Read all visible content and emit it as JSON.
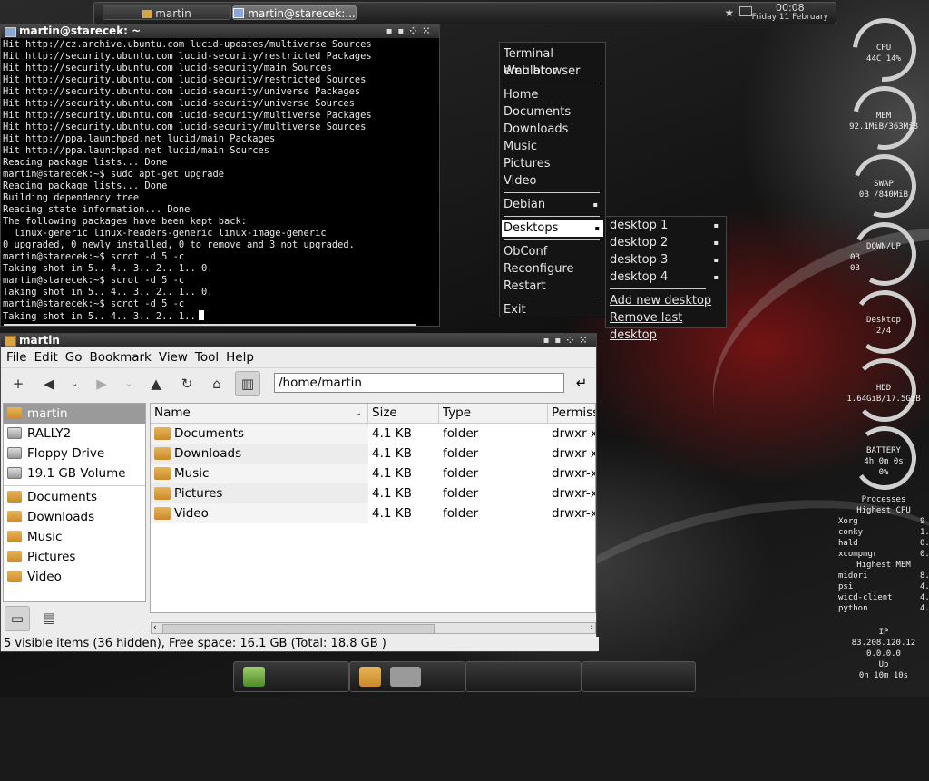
{
  "top_panel": {
    "tasks": [
      {
        "label": "martin",
        "icon": "folder-icon"
      },
      {
        "label": "martin@starecek:...",
        "icon": "terminal-icon"
      }
    ],
    "clock": {
      "time": "00:08",
      "date": "Friday 11 February"
    },
    "tray_icons": [
      "bookmark-star-icon",
      "network-icon"
    ]
  },
  "terminal": {
    "title": "martin@starecek: ~",
    "title_buttons": [
      "iconify-icon",
      "maximize-icon",
      "close-icon"
    ],
    "lines": [
      "Hit http://cz.archive.ubuntu.com lucid-updates/multiverse Sources",
      "Hit http://security.ubuntu.com lucid-security/restricted Packages",
      "Hit http://security.ubuntu.com lucid-security/main Sources",
      "Hit http://security.ubuntu.com lucid-security/restricted Sources",
      "Hit http://security.ubuntu.com lucid-security/universe Packages",
      "Hit http://security.ubuntu.com lucid-security/universe Sources",
      "Hit http://security.ubuntu.com lucid-security/multiverse Packages",
      "Hit http://security.ubuntu.com lucid-security/multiverse Sources",
      "Hit http://ppa.launchpad.net lucid/main Packages",
      "Hit http://ppa.launchpad.net lucid/main Sources",
      "Reading package lists... Done",
      "martin@starecek:~$ sudo apt-get upgrade",
      "Reading package lists... Done",
      "Building dependency tree",
      "Reading state information... Done",
      "The following packages have been kept back:",
      "  linux-generic linux-headers-generic linux-image-generic",
      "0 upgraded, 0 newly installed, 0 to remove and 3 not upgraded.",
      "martin@starecek:~$ scrot -d 5 -c",
      "Taking shot in 5.. 4.. 3.. 2.. 1.. 0.",
      "martin@starecek:~$ scrot -d 5 -c",
      "Taking shot in 5.. 4.. 3.. 2.. 1.. 0.",
      "martin@starecek:~$ scrot -d 5 -c",
      "Taking shot in 5.. 4.. 3.. 2.. 1.."
    ]
  },
  "root_menu": {
    "groups": [
      [
        "Terminal emulator",
        "Web browser"
      ],
      [
        "Home",
        "Documents",
        "Downloads",
        "Music",
        "Pictures",
        "Video"
      ],
      [
        "Debian"
      ],
      [
        "Desktops"
      ],
      [
        "ObConf",
        "Reconfigure",
        "Restart"
      ],
      [
        "Exit"
      ]
    ],
    "submenu_items": [
      "Debian",
      "Desktops"
    ],
    "active": "Desktops"
  },
  "desktops_menu": {
    "desktops": [
      "desktop 1",
      "desktop 2",
      "desktop 3",
      "desktop 4"
    ],
    "actions": [
      "Add new desktop",
      "Remove last desktop"
    ]
  },
  "file_manager": {
    "title": "martin",
    "menubar": [
      "File",
      "Edit",
      "Go",
      "Bookmark",
      "View",
      "Tool",
      "Help"
    ],
    "toolbar_icons": [
      "new-tab-icon",
      "back-icon",
      "back-history-icon",
      "forward-icon",
      "forward-history-icon",
      "up-icon",
      "reload-icon",
      "home-icon",
      "side-pane-icon"
    ],
    "path": "/home/martin",
    "go_icon": "go-icon",
    "places": [
      {
        "label": "martin",
        "icon": "home-folder-icon",
        "selected": true
      },
      {
        "label": "RALLY2",
        "icon": "usb-drive-icon",
        "selected": false
      },
      {
        "label": "Floppy Drive",
        "icon": "floppy-drive-icon",
        "selected": false
      },
      {
        "label": "19.1 GB Volume",
        "icon": "hard-drive-icon",
        "selected": false
      }
    ],
    "bookmarks": [
      "Documents",
      "Downloads",
      "Music",
      "Pictures",
      "Video"
    ],
    "side_bottom_icons": [
      "places-view-icon",
      "directory-tree-icon"
    ],
    "columns": [
      "Name",
      "Size",
      "Type",
      "Permiss"
    ],
    "rows": [
      {
        "name": "Documents",
        "size": "4.1 KB",
        "type": "folder",
        "perm": "drwxr-xr-"
      },
      {
        "name": "Downloads",
        "size": "4.1 KB",
        "type": "folder",
        "perm": "drwxr-xr-"
      },
      {
        "name": "Music",
        "size": "4.1 KB",
        "type": "folder",
        "perm": "drwxr-xr-"
      },
      {
        "name": "Pictures",
        "size": "4.1 KB",
        "type": "folder",
        "perm": "drwxr-xr-"
      },
      {
        "name": "Video",
        "size": "4.1 KB",
        "type": "folder",
        "perm": "drwxr-xr-"
      }
    ],
    "status": "5 visible items (36 hidden), Free space: 16.1 GB (Total: 18.8 GB )"
  },
  "bottom_panel": {
    "icons": [
      "app-launcher-icon",
      "file-manager-icon",
      "terminal-window-icon"
    ]
  },
  "conky": {
    "gauges": [
      {
        "title": "CPU",
        "lines": [
          "44C  14%"
        ],
        "level": 0.14
      },
      {
        "title": "MEM",
        "lines": [
          "92.1MiB/363MiB"
        ],
        "level": 0.25
      },
      {
        "title": "SWAP",
        "lines": [
          "0B  /840MiB"
        ],
        "level": 0.0
      },
      {
        "title": "DOWN/UP",
        "lines": [
          "0B",
          "0B"
        ],
        "level": 0.0
      },
      {
        "title": "Desktop",
        "lines": [
          "2/4"
        ],
        "level": 0.5
      },
      {
        "title": "HDD",
        "lines": [
          "1.64GiB/17.5GiB"
        ],
        "level": 0.09
      },
      {
        "title": "BATTERY",
        "lines": [
          "4h 0m 0s",
          "0%"
        ],
        "level": 0.0
      }
    ],
    "processes": {
      "title": "Processes",
      "cpu_title": "Highest CPU",
      "cpu": [
        {
          "name": "Xorg",
          "value": "9"
        },
        {
          "name": "conky",
          "value": "1."
        },
        {
          "name": "hald",
          "value": "0."
        },
        {
          "name": "xcompmgr",
          "value": "0."
        }
      ],
      "mem_title": "Highest MEM",
      "mem": [
        {
          "name": "midori",
          "value": "8."
        },
        {
          "name": "psi",
          "value": "4."
        },
        {
          "name": "wicd-client",
          "value": "4."
        },
        {
          "name": "python",
          "value": "4."
        }
      ]
    },
    "ip": {
      "title": "IP",
      "lines": [
        "83.208.120.12",
        "0.0.0.0"
      ]
    },
    "uptime": {
      "title": "Up",
      "value": "0h 10m 10s"
    }
  },
  "colors": {
    "menu_bg": "#141414",
    "menu_active": "#ffffff",
    "panel": "#2a2a2a",
    "wallpaper_accent": "#8c1a1a",
    "folder": "#d9a441"
  }
}
